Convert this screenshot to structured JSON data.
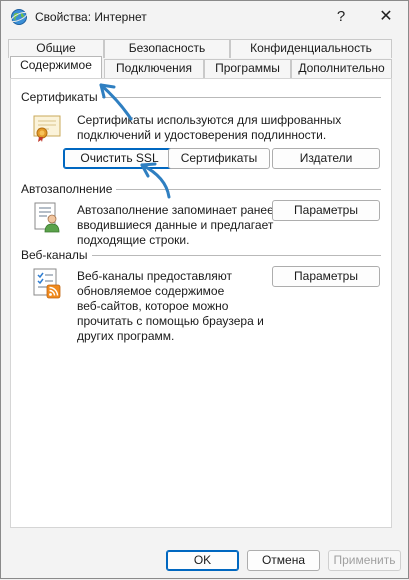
{
  "window": {
    "title": "Свойства: Интернет",
    "help_label": "?",
    "close_label": "✕"
  },
  "tabs": {
    "row1": [
      {
        "label": "Общие",
        "active": false
      },
      {
        "label": "Безопасность",
        "active": false
      },
      {
        "label": "Конфиденциальность",
        "active": false
      }
    ],
    "row2": [
      {
        "label": "Содержимое",
        "active": true
      },
      {
        "label": "Подключения",
        "active": false
      },
      {
        "label": "Программы",
        "active": false
      },
      {
        "label": "Дополнительно",
        "active": false
      }
    ]
  },
  "certificates": {
    "heading": "Сертификаты",
    "description_line1": "Сертификаты используются для шифрованных",
    "description_line2": "подключений и удостоверения подлинности.",
    "clear_ssl_label": "Очистить SSL",
    "certificates_label": "Сертификаты",
    "publishers_label": "Издатели",
    "icon": "certificate-icon"
  },
  "autocomplete": {
    "heading": "Автозаполнение",
    "description_line1": "Автозаполнение запоминает ранее",
    "description_line2": "вводившиеся данные и предлагает",
    "description_line3": "подходящие строки.",
    "settings_label": "Параметры",
    "icon": "autocomplete-icon"
  },
  "feeds": {
    "heading": "Веб-каналы",
    "description_line1": "Веб-каналы предоставляют",
    "description_line2": "обновляемое содержимое",
    "description_line3": "веб-сайтов, которое можно",
    "description_line4": "прочитать с помощью браузера и",
    "description_line5": "других программ.",
    "settings_label": "Параметры",
    "icon": "rss-feed-icon"
  },
  "footer": {
    "ok_label": "OK",
    "cancel_label": "Отмена",
    "apply_label": "Применить"
  },
  "colors": {
    "accent": "#0067c0",
    "annotation_arrow": "#2f7fc1"
  }
}
